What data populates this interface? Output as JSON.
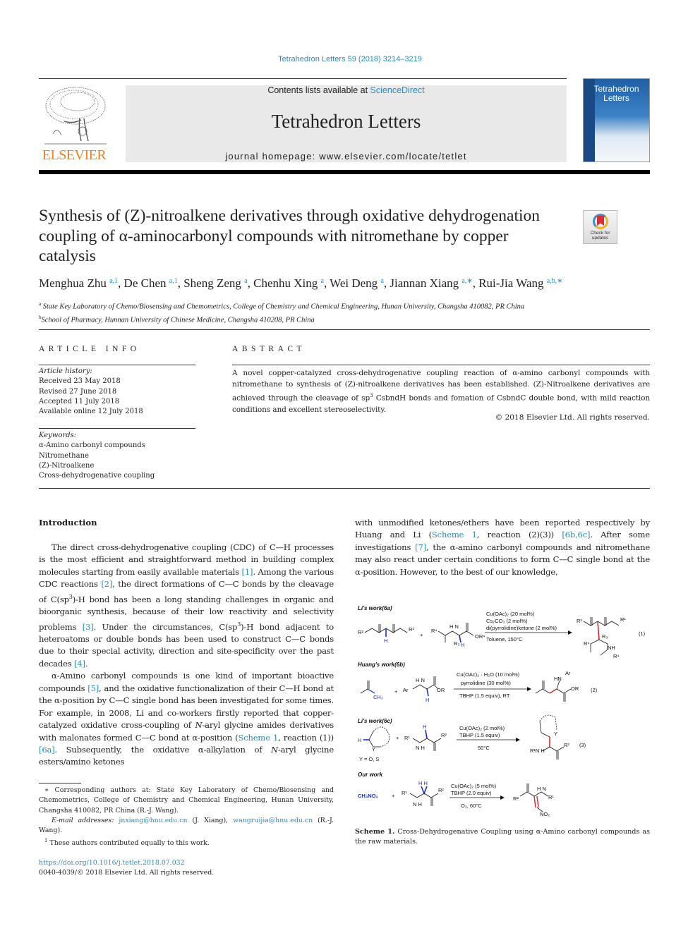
{
  "journal_ref": "Tetrahedron Letters 59 (2018) 3214–3219",
  "masthead": {
    "contents_prefix": "Contents lists available at ",
    "contents_link": "ScienceDirect",
    "journal_title": "Tetrahedron Letters",
    "homepage": "journal homepage: www.elsevier.com/locate/tetlet",
    "publisher_logo_text": "ELSEVIER",
    "cover_title": "Tetrahedron Letters",
    "colors": {
      "link": "#2a8bbf",
      "elsevier_orange": "#f07f1d",
      "masthead_bg": "#e9e9e9"
    }
  },
  "article": {
    "title": "Synthesis of (Z)-nitroalkene derivatives through oxidative dehydrogenation coupling of α-aminocarbonyl compounds with nitromethane by copper catalysis",
    "check_updates_label": "Check for updates",
    "authors": [
      {
        "name": "Menghua Zhu",
        "affil": "a,1"
      },
      {
        "name": "De Chen",
        "affil": "a,1"
      },
      {
        "name": "Sheng Zeng",
        "affil": "a"
      },
      {
        "name": "Chenhu Xing",
        "affil": "a"
      },
      {
        "name": "Wei Deng",
        "affil": "a"
      },
      {
        "name": "Jiannan Xiang",
        "affil": "a,∗"
      },
      {
        "name": "Rui-Jia Wang",
        "affil": "a,b,∗"
      }
    ],
    "affiliations": [
      {
        "mark": "a",
        "text": "State Key Laboratory of Chemo/Biosensing and Chemometrics, College of Chemistry and Chemical Engineering, Hunan University, Changsha 410082, PR China"
      },
      {
        "mark": "b",
        "text": "School of Pharmacy, Hunnan University of Chinese Medicine, Changsha 410208, PR China"
      }
    ]
  },
  "article_info": {
    "heading": "ARTICLE INFO",
    "history_label": "Article history:",
    "history": [
      "Received 23 May 2018",
      "Revised 27 June 2018",
      "Accepted 11 July 2018",
      "Available online 12 July 2018"
    ],
    "keywords_label": "Keywords:",
    "keywords": [
      "α-Amino carbonyl compounds",
      "Nitromethane",
      "(Z)-Nitroalkene",
      "Cross-dehydrogenative coupling"
    ]
  },
  "abstract": {
    "heading": "ABSTRACT",
    "text_1": "A novel copper-catalyzed cross-dehydrogenative coupling reaction of α-amino carbonyl compounds with nitromethane to synthesis of (Z)-nitroalkene derivatives has been established. (Z)-Nitroalkene derivatives are achieved through the cleavage of sp",
    "text_sup": "3",
    "text_2": " CsbndH bonds and fomation of CsbndC double bond, with mild reaction conditions and excellent stereoselectivity.",
    "copyright": "© 2018 Elsevier Ltd. All rights reserved."
  },
  "body": {
    "intro_heading": "Introduction",
    "p1": [
      "The direct cross-dehydrogenative coupling (CDC) of C—H processes is the most efficient and straightforward method in building complex molecules starting from easily available materials ",
      "[1]",
      ". Among the various CDC reactions ",
      "[2]",
      ", the direct formations of C—C bonds by the cleavage of C(sp",
      "3",
      ")-H bond has been a long standing challenges in organic and bioorganic synthesis, because of their low reactivity and selectivity problems ",
      "[3]",
      ". Under the circumstances, C(sp",
      "3",
      ")-H bond adjacent to heteroatoms or double bonds has been used to construct C—C bonds due to their special activity, direction and site-specificity over the past decades ",
      "[4]",
      "."
    ],
    "p2": [
      "α-Amino carbonyl compounds is one kind of important bioactive compounds ",
      "[5]",
      ", and the oxidative functionalization of their C—H bond at the α-position by C—C single bond has been investigated for some times. For example, in 2008, Li and co-workers firstly reported that copper-catalyzed oxidative cross-coupling of ",
      "N",
      "-aryl glycine amides derivatives with malonates formed C—C bond at α-position (",
      "Scheme 1",
      ", reaction (1)) ",
      "[6a]",
      ". Subsequently, the oxidative α-alkylation of ",
      "N",
      "-aryl glycine esters/amino ketones"
    ],
    "p3": [
      "with unmodified ketones/ethers have been reported respectively by Huang and Li (",
      "Scheme 1",
      ", reaction (2)(3)) ",
      "[6b,6c]",
      ". After some investigations ",
      "[7]",
      ", the α-amino carbonyl compounds and nitromethane may also react under certain conditions to form C—C single bond at the α-position. However, to the best of our knowledge,"
    ]
  },
  "footnotes": {
    "corresponding": "∗ Corresponding authors at: State Key Laboratory of Chemo/Biosensing and Chemometrics, College of Chemistry and Chemical Engineering, Hunan University, Changsha 410082, PR China (R.-J. Wang).",
    "email_label": "E-mail addresses: ",
    "email_1": "jnxiang@hnu.edu.cn",
    "email_1_name": " (J. Xiang), ",
    "email_2": "wangruijia@hnu.edu.cn",
    "email_2_name": " (R.-J. Wang).",
    "equal_mark": "1",
    "equal": " These authors contributed equally to this work.",
    "doi": "https://doi.org/10.1016/j.tetlet.2018.07.032",
    "issn": "0040-4039/© 2018 Elsevier Ltd. All rights reserved."
  },
  "scheme": {
    "caption_label": "Scheme 1.",
    "caption_text": " Cross-Dehydrogenative Coupling using α-Amino carbonyl compounds as the raw materials.",
    "rows": [
      {
        "label": "Li's work(6a)",
        "conditions_above": [
          "Cu(OAc)₂ (20 mol%)",
          "Cs₂CO₃ (2 mol%)",
          "di(pyrrolidine)ketone (2 mol%)"
        ],
        "conditions_below": [
          "Toluene, 150°C"
        ],
        "number": "(1)"
      },
      {
        "label": "Huang's work(6b)",
        "conditions_above": [
          "Cu(OAc)₂ · H₂O (10 mol%)",
          "pyrrolidine (30 mol%)"
        ],
        "conditions_below": [
          "TBHP (1.5 equiv), RT"
        ],
        "number": "(2)"
      },
      {
        "label": "Li's work(6c)",
        "conditions_above": [
          "Cu(OAc)₂ (2 mol%)",
          "TBHP (1.5 equiv)"
        ],
        "conditions_below": [
          "50°C"
        ],
        "note": "Y = O, S",
        "number": "(3)"
      },
      {
        "label": "Our work",
        "reagent": "CH₃NO₂",
        "conditions_above": [
          "Cu(OAc)₂ (5 mol%)",
          "TBHP (2.0 equiv)"
        ],
        "conditions_below": [
          "O₂, 60°C"
        ]
      }
    ],
    "colors": {
      "reactive_bond": "#1b2bd6",
      "new_bond": "#e0242a"
    }
  }
}
